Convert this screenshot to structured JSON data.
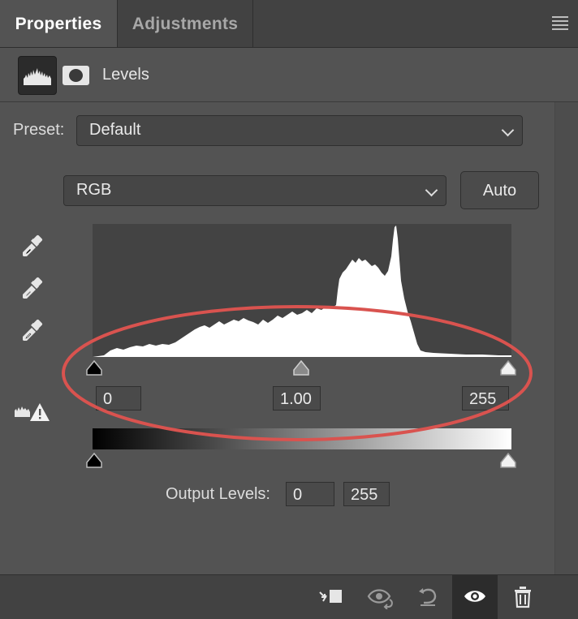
{
  "tabs": [
    {
      "label": "Properties",
      "active": true
    },
    {
      "label": "Adjustments",
      "active": false
    }
  ],
  "header": {
    "title": "Levels"
  },
  "preset": {
    "label": "Preset:",
    "value": "Default"
  },
  "channel": {
    "value": "RGB"
  },
  "auto_button": {
    "label": "Auto"
  },
  "input_levels": {
    "black": "0",
    "gamma": "1.00",
    "white": "255"
  },
  "output_levels": {
    "label": "Output Levels:",
    "black": "0",
    "white": "255"
  },
  "icons": {
    "menu": "panel-menu-icon",
    "levels": "levels-histogram-icon",
    "mask": "layer-mask-icon",
    "black_point": "black-point-eyedropper-icon",
    "gray_point": "gray-point-eyedropper-icon",
    "white_point": "white-point-eyedropper-icon",
    "clipping": "clipping-warning-icon",
    "clip_to_layer": "clip-to-layer-icon",
    "view_previous": "view-previous-state-icon",
    "reset": "reset-icon",
    "visibility": "visibility-eye-icon",
    "delete": "trash-icon"
  },
  "colors": {
    "panel_bg": "#535353",
    "annotation": "#d9534f"
  }
}
